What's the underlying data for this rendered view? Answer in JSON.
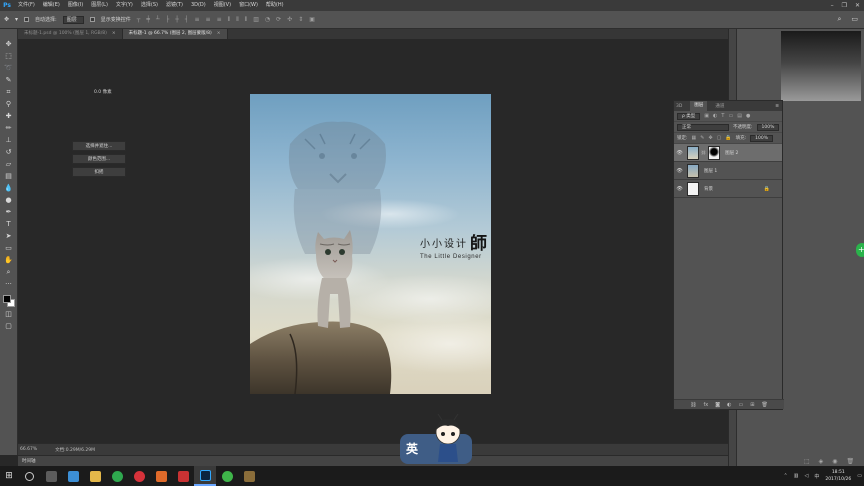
{
  "app": {
    "logo": "Ps",
    "menu": [
      "文件(F)",
      "编辑(E)",
      "图像(I)",
      "图层(L)",
      "文字(Y)",
      "选择(S)",
      "滤镜(T)",
      "3D(D)",
      "视图(V)",
      "窗口(W)",
      "帮助(H)"
    ],
    "window_controls": [
      "–",
      "❐",
      "✕"
    ]
  },
  "options_bar": {
    "auto_select_label": "自动选择:",
    "auto_select_value": "图层",
    "show_transform_label": "显示变换控件"
  },
  "tabs": [
    {
      "label": "未标题-1.psd @ 100% (图层 1, RGB/8)",
      "close": "×",
      "active": false
    },
    {
      "label": "未标题-1 @ 66.7% (图层 2, 图层蒙版/8)",
      "close": "×",
      "active": true
    }
  ],
  "document": {
    "title_main": "小小设计",
    "title_big": "師",
    "subtitle": "The Little Designer"
  },
  "status": {
    "zoom": "66.67%",
    "doc_info": "文档:0.29M/6.29M",
    "timeline_label": "时间轴"
  },
  "layers_panel": {
    "tabs": [
      "3D",
      "图层",
      "通道"
    ],
    "kind_filter": "ρ 类型",
    "blend_mode": "正常",
    "opacity_label": "不透明度:",
    "opacity_value": "100%",
    "lock_label": "锁定:",
    "fill_label": "填充:",
    "fill_value": "100%",
    "layers": [
      {
        "name": "图层 2",
        "selected": true
      },
      {
        "name": "图层 1",
        "selected": false
      },
      {
        "name": "背景",
        "selected": false
      }
    ]
  },
  "right_dock": {
    "value": "0.0 像素",
    "buttons": [
      "选择并遮住...",
      "颜色范围...",
      "扣摇"
    ]
  },
  "taskbar": {
    "time": "18:51",
    "date": "2017/10/26"
  },
  "overlay": {
    "char": "英"
  }
}
